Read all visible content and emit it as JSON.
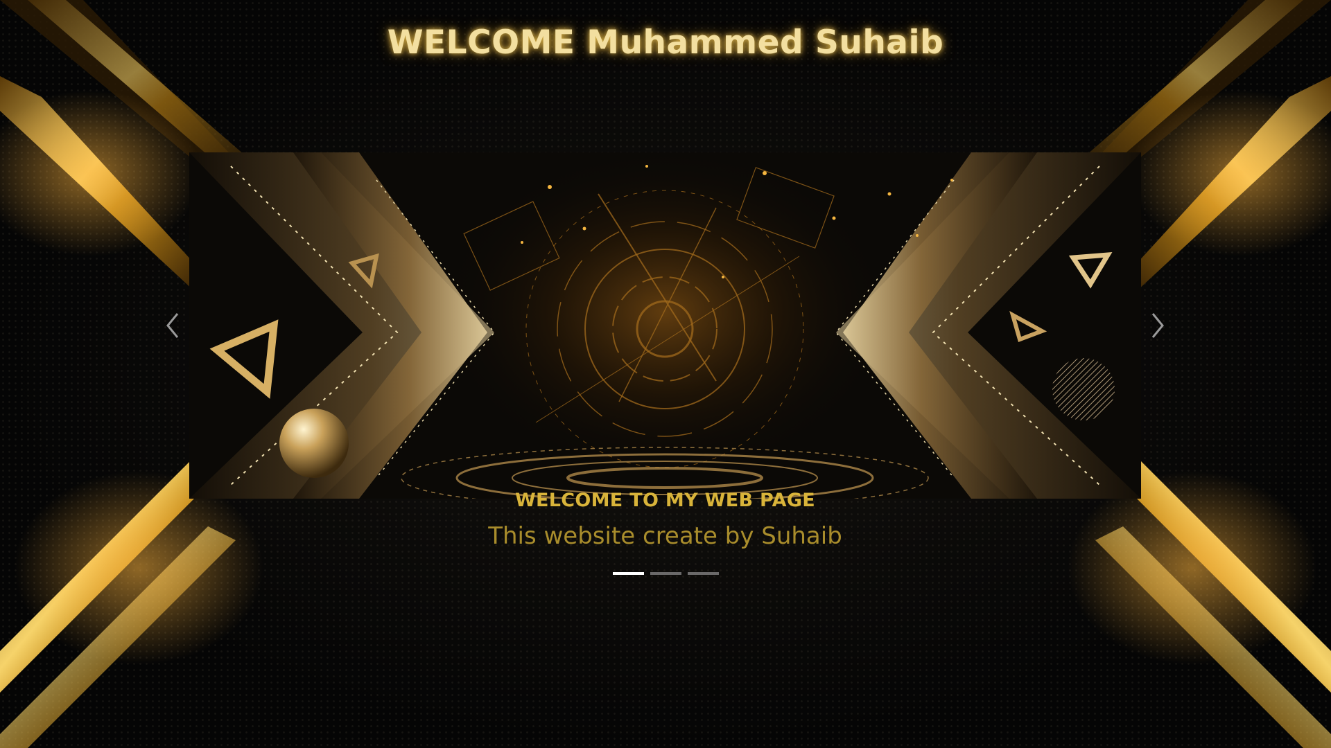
{
  "page": {
    "title": "WELCOME Muhammed Suhaib"
  },
  "carousel": {
    "slides": [
      {
        "caption_title": "WELCOME TO MY WEB PAGE",
        "caption_text": "This website create by Suhaib"
      }
    ],
    "active_index": 0,
    "indicator_count": 3,
    "prev_icon": "chevron-left-icon",
    "next_icon": "chevron-right-icon"
  },
  "colors": {
    "accent_gold": "#d9b43a",
    "title_glow": "#f3dfa0",
    "background": "#060606"
  }
}
